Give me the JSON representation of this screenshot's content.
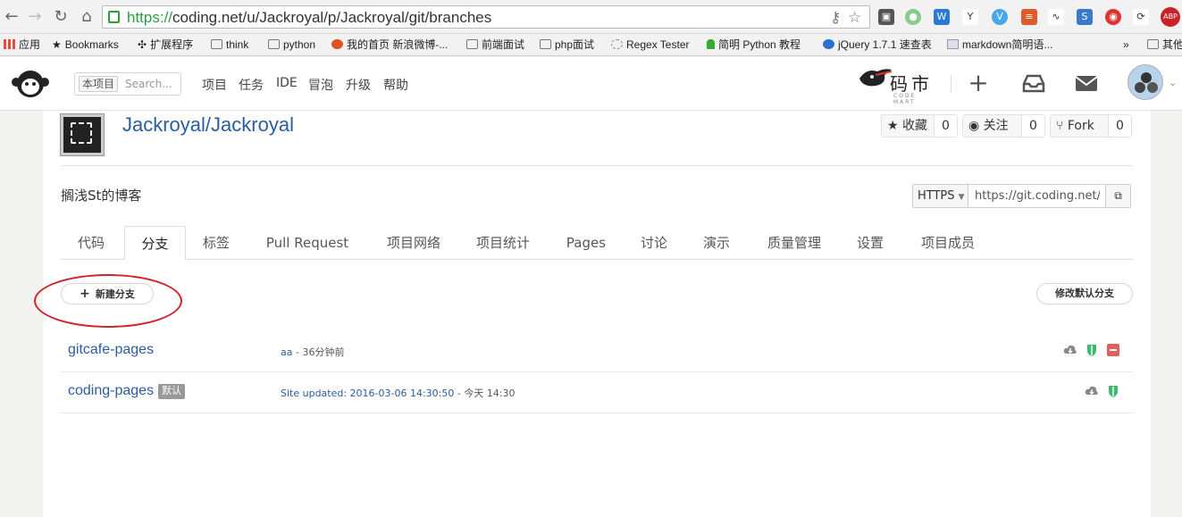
{
  "browser": {
    "url_scheme": "https://",
    "url_rest": "coding.net/u/Jackroyal/p/Jackroyal/git/branches"
  },
  "bookmarks": [
    {
      "label": "应用",
      "icon": "apps-grid-icon"
    },
    {
      "label": "Bookmarks",
      "icon": "star-icon"
    },
    {
      "label": "扩展程序",
      "icon": "puzzle-icon"
    },
    {
      "label": "think",
      "icon": "folder-icon"
    },
    {
      "label": "python",
      "icon": "folder-icon"
    },
    {
      "label": "我的首页 新浪微博-...",
      "icon": "weibo-icon"
    },
    {
      "label": "前端面试",
      "icon": "folder-icon"
    },
    {
      "label": "php面试",
      "icon": "folder-icon"
    },
    {
      "label": "Regex Tester",
      "icon": "regex-icon"
    },
    {
      "label": "简明 Python 教程",
      "icon": "tree-icon"
    },
    {
      "label": "jQuery 1.7.1 速查表",
      "icon": "jquery-icon"
    },
    {
      "label": "markdown简明语...",
      "icon": "markdown-icon"
    },
    {
      "label": "»",
      "icon": ""
    },
    {
      "label": "其他",
      "icon": "folder-icon"
    }
  ],
  "header": {
    "search_scope": "本项目",
    "search_placeholder": "Search...",
    "nav": [
      "项目",
      "任务",
      "IDE",
      "冒泡",
      "升级",
      "帮助"
    ],
    "brand_text": "码市",
    "brand_sub": "CODE MART"
  },
  "project": {
    "title": "Jackroyal/Jackroyal",
    "description": "搁浅St的博客",
    "star_label": "收藏",
    "star_count": "0",
    "watch_label": "关注",
    "watch_count": "0",
    "fork_label": "Fork",
    "fork_count": "0",
    "clone_protocol": "HTTPS",
    "clone_url": "https://git.coding.net/"
  },
  "tabs": [
    "代码",
    "分支",
    "标签",
    "Pull Request",
    "项目网络",
    "项目统计",
    "Pages",
    "讨论",
    "演示",
    "质量管理",
    "设置",
    "项目成员"
  ],
  "active_tab": "分支",
  "actions": {
    "new_branch": "新建分支",
    "change_default": "修改默认分支"
  },
  "branches": [
    {
      "name": "gitcafe-pages",
      "badge": "",
      "commit": "aa",
      "sep": " - ",
      "time": "36分钟前",
      "deletable": true
    },
    {
      "name": "coding-pages",
      "badge": "默认",
      "commit": "Site updated: 2016-03-06 14:30:50",
      "sep": " - ",
      "time": "今天 14:30",
      "deletable": false
    }
  ],
  "colors": {
    "link": "#2a5d9f",
    "url_green": "#2e9b3c",
    "protect_green": "#3cba72",
    "delete_red": "#e06060",
    "annotation_red": "#d3202a"
  }
}
